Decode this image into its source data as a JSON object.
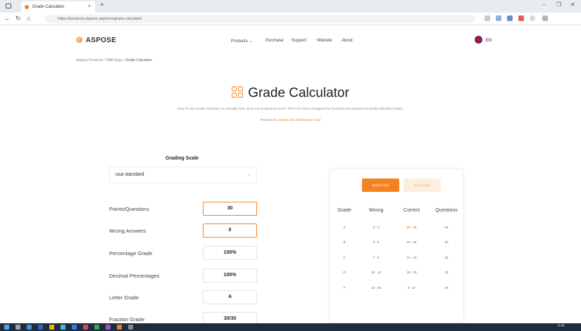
{
  "browser": {
    "tab_title": "Grade Calculator",
    "tab_close": "×",
    "new_tab": "+",
    "url": "https://products.aspose.app/omr/grade-calculator",
    "min": "–",
    "max": "❐",
    "close": "✕"
  },
  "site": {
    "logo_text": "ASPOSE",
    "menu": [
      "Products",
      "Purchase",
      "Support",
      "Website",
      "About"
    ],
    "products_caret": "⌄",
    "language": "EN"
  },
  "breadcrumb": {
    "path": "Aspose.Products / OMR Apps / ",
    "current": "Grade Calculator"
  },
  "hero": {
    "title": "Grade Calculator",
    "subtitle": "Easy To Use Grade Calculator To Calculate Test, Quiz And Assignment Score. This Free Tool Is Designed For Teachers And Students To Easily Calculate Grades.",
    "powered_prefix": "Powered by ",
    "powered_link1": "aspose.com",
    "powered_mid": " and ",
    "powered_link2": "aspose.cloud"
  },
  "form": {
    "grading_scale_label": "Grading Scale",
    "grading_scale_value": "usa standard",
    "rows": [
      {
        "label": "Points/Questions",
        "value": "30"
      },
      {
        "label": "Wrong Answers",
        "value": "0"
      },
      {
        "label": "Percentage Grade",
        "value": "100%"
      },
      {
        "label": "Decimal Percentages",
        "value": "100%"
      },
      {
        "label": "Letter Grade",
        "value": "A"
      },
      {
        "label": "Fraction Grade",
        "value": "30/30"
      }
    ]
  },
  "chart_panel": {
    "quick_chart_label": "Quick Chart",
    "scale_chart_label": "Scale Chart",
    "headers": [
      "Grade",
      "Wrong",
      "Correct",
      "Questions"
    ],
    "rows": [
      [
        "A",
        "0 - 3",
        "27 - 30",
        "30"
      ],
      [
        "B",
        "4 - 6",
        "24 - 26",
        "30"
      ],
      [
        "C",
        "7 - 9",
        "21 - 23",
        "30"
      ],
      [
        "D",
        "10 - 12",
        "18 - 20",
        "30"
      ],
      [
        "F",
        "13 - 30",
        "0 - 17",
        "30"
      ]
    ]
  },
  "taskbar": {
    "time": "9:45"
  },
  "colors": {
    "accent": "#f58220",
    "accent_light": "#fdeede",
    "taskbar": "#1e2c3e"
  }
}
